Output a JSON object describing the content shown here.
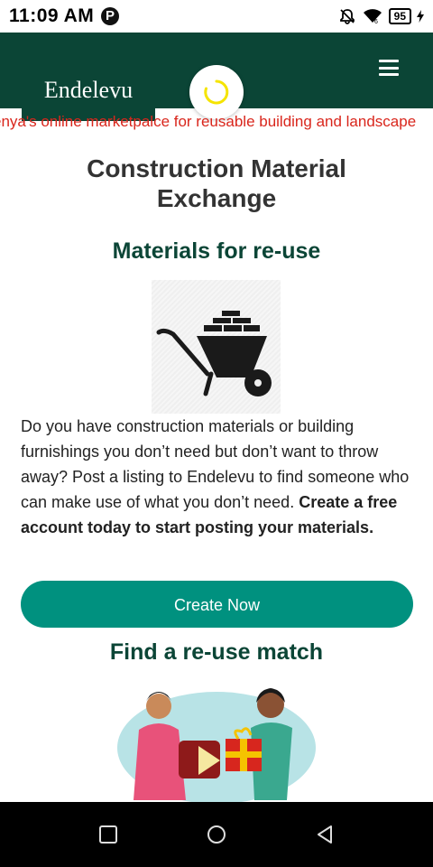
{
  "status": {
    "time": "11:09 AM",
    "battery": "95"
  },
  "header": {
    "logo": "Endelevu"
  },
  "ticker": {
    "text": "enya's online marketpalce for reusable building and landscape"
  },
  "main": {
    "title": "Construction Material Exchange",
    "section1_title": "Materials for re-use",
    "paragraph_plain": "Do you have construction materials or building furnishings you don’t need but don’t want to throw away? Post a listing to Endelevu to find someone who can make use of what you don’t need. ",
    "paragraph_bold": "Create a free account today to start posting your materials.",
    "cta_label": "Create Now",
    "section2_title": "Find a re-use match"
  },
  "colors": {
    "header_bg": "#0b4536",
    "accent_button": "#00917f",
    "ticker_text": "#d9261c",
    "spinner": "#f5e400"
  },
  "icons": [
    "p-app-icon",
    "silent-icon",
    "wifi-icon",
    "battery-icon",
    "charging-icon",
    "menu-icon",
    "loading-spinner-icon",
    "wheelbarrow-icon",
    "square-nav-icon",
    "circle-nav-icon",
    "back-nav-icon"
  ]
}
